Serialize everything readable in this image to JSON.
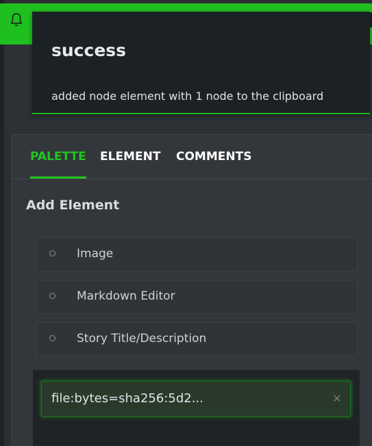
{
  "notification": {
    "title": "success",
    "message": "added node element with 1 node to the clipboard",
    "bell_icon": "bell-icon",
    "accent_color": "#20b320"
  },
  "tabs": [
    {
      "label": "PALETTE",
      "active": true
    },
    {
      "label": "ELEMENT",
      "active": false
    },
    {
      "label": "COMMENTS",
      "active": false
    }
  ],
  "palette": {
    "section_title": "Add Element",
    "items": [
      {
        "label": "Image"
      },
      {
        "label": "Markdown Editor"
      },
      {
        "label": "Story Title/Description"
      }
    ]
  },
  "file_input": {
    "value": "file:bytes=sha256:5d2...",
    "clear_icon": "close-icon"
  },
  "colors": {
    "accent": "#21c521",
    "background": "#2b2f33",
    "panel": "#33373b"
  }
}
